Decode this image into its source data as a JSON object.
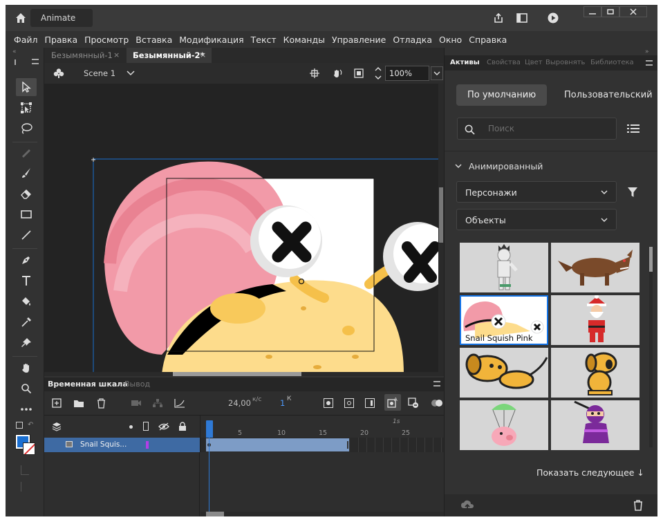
{
  "app": {
    "name": "Animate"
  },
  "menu": [
    "Файл",
    "Правка",
    "Просмотр",
    "Вставка",
    "Модификация",
    "Текст",
    "Команды",
    "Управление",
    "Отладка",
    "Окно",
    "Справка"
  ],
  "doc_tabs": [
    {
      "label": "Безымянный-1",
      "active": false
    },
    {
      "label": "Безымянный-2*",
      "active": true
    }
  ],
  "edit_bar": {
    "scene": "Scene 1",
    "zoom": "100%"
  },
  "timeline": {
    "tabs": [
      "Временная шкала",
      "Вывод"
    ],
    "fps": "24,00",
    "fps_unit": "к/с",
    "frame": "1",
    "frame_suffix": "К",
    "ruler": [
      "5",
      "10",
      "15",
      "20",
      "25"
    ],
    "time_marker": "1s",
    "layer_name": "Snail Squis..."
  },
  "panel": {
    "tabs": [
      "Активы",
      "Свойства",
      "Цвет",
      "Выровнять",
      "Библиотека"
    ],
    "buttons": {
      "default": "По умолчанию",
      "custom": "Пользовательский"
    },
    "search_placeholder": "Поиск",
    "section": "Анимированный",
    "dropdowns": [
      "Персонажи",
      "Объекты"
    ],
    "selected_caption": "Snail Squish Pink",
    "show_more": "Показать следующее ↓"
  },
  "colors": {
    "accent": "#1473e6",
    "stroke": "#1a6fd1",
    "fill": "#ffffff",
    "snail_pink": "#f29aa8",
    "snail_body": "#fddc8c"
  },
  "icons": [
    "home-icon",
    "share-icon",
    "panel-icon",
    "play-icon",
    "minimize-icon",
    "maximize-icon",
    "close-icon",
    "selection-tool-icon",
    "free-transform-tool-icon",
    "lasso-tool-icon",
    "brush-icon",
    "eraser-icon",
    "rectangle-icon",
    "line-icon",
    "pen-icon",
    "text-icon",
    "paint-bucket-icon",
    "eyedropper-icon",
    "pin-icon",
    "hand-icon",
    "zoom-icon",
    "more-icon",
    "search-icon",
    "filter-icon",
    "list-view-icon",
    "trash-icon",
    "upload-icon"
  ]
}
